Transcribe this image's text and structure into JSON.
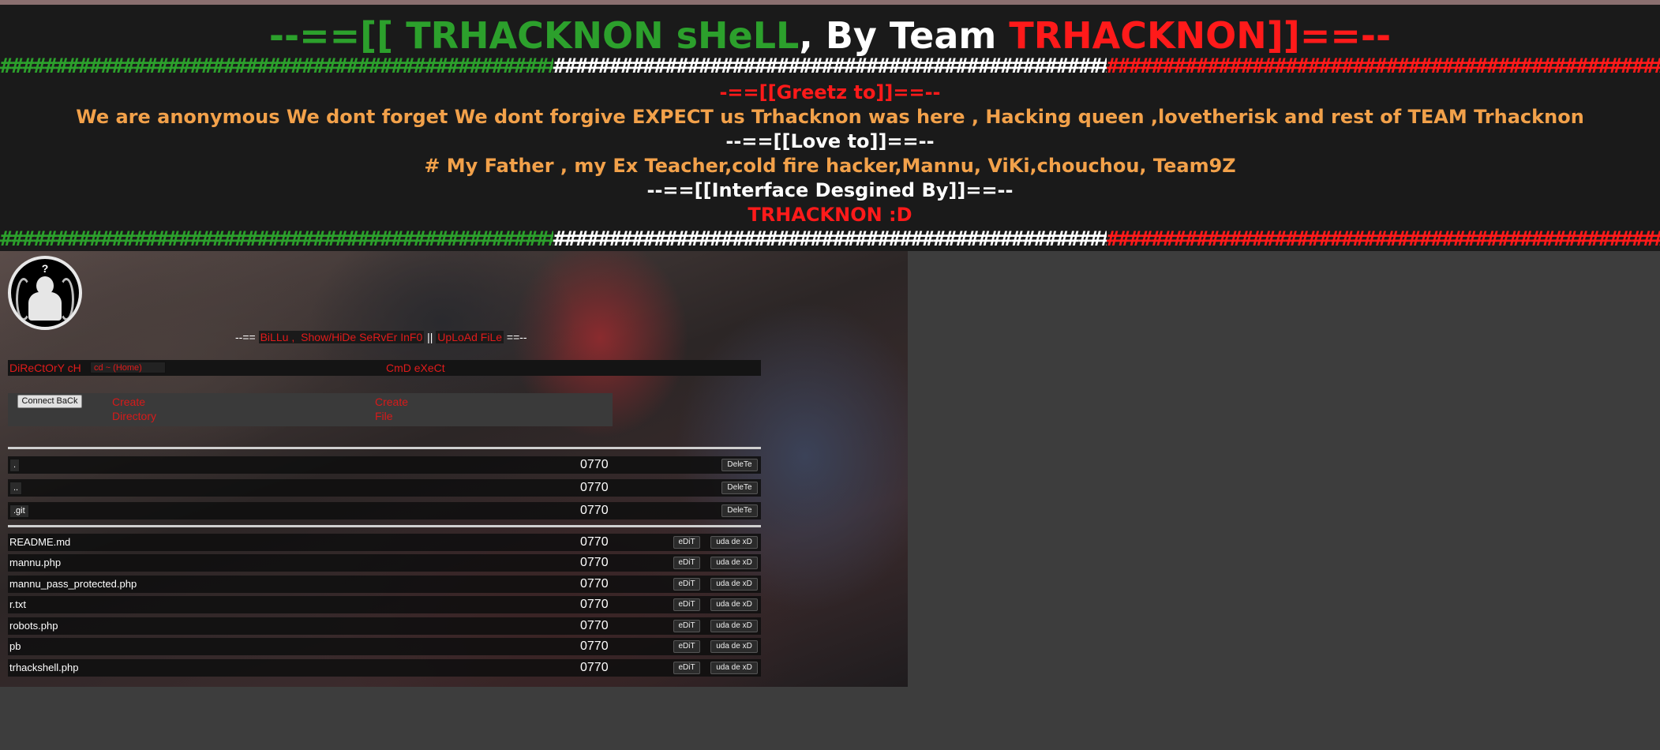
{
  "banner": {
    "title_part1": "--==[[ TRHACKNON sHeLL",
    "title_part2": ", By Team ",
    "title_part3": "TRHACKNON",
    "title_part4": "]]==--",
    "hash_text": "##########################################################################################",
    "greetz_heading": "-==[[Greetz to]]==--",
    "greetz_text": "We are anonymous We dont forget We dont forgive EXPECT us Trhacknon was here , Hacking queen ,lovetherisk and rest of TEAM Trhacknon",
    "love_heading": "--==[[Love to]]==--",
    "love_text": "# My Father , my Ex Teacher,cold fire hacker,Mannu, ViKi,chouchou, Team9Z",
    "interface_heading": "--==[[Interface Desgined By]]==--",
    "interface_text": "TRHACKNON :D",
    "colors": {
      "green": "#2ca02c",
      "white": "#ffffff",
      "red": "#ff1a1a",
      "orange": "#f2a14a",
      "background": "#1a1a1a"
    }
  },
  "shell": {
    "logo": {
      "icon": "anonymous-logo-icon",
      "mark": "?"
    },
    "links": {
      "prefix": "--==",
      "billu": "BiLLu",
      "sep1": ", ",
      "toggle_info": "Show/HiDe SeRvEr InF0",
      "sep2": " || ",
      "upload": "UpLoAd FiLe",
      "suffix": "==--"
    },
    "directory_label": "DiReCtOrY cH",
    "directory_value": "cd ~ (Home)",
    "cmd_label": "CmD eXeCt",
    "connect_back": "Connect BaCk",
    "create_dir": [
      "Create",
      "Directory"
    ],
    "create_file": [
      "Create",
      "File"
    ],
    "directories": [
      {
        "name": ".",
        "perm": "0770",
        "action": "DeleTe"
      },
      {
        "name": "..",
        "perm": "0770",
        "action": "DeleTe"
      },
      {
        "name": ".git",
        "perm": "0770",
        "action": "DeleTe"
      }
    ],
    "files": [
      {
        "name": "README.md",
        "perm": "0770",
        "edit": "eDiT",
        "delete": "uda de xD"
      },
      {
        "name": "mannu.php",
        "perm": "0770",
        "edit": "eDiT",
        "delete": "uda de xD"
      },
      {
        "name": "mannu_pass_protected.php",
        "perm": "0770",
        "edit": "eDiT",
        "delete": "uda de xD"
      },
      {
        "name": "r.txt",
        "perm": "0770",
        "edit": "eDiT",
        "delete": "uda de xD"
      },
      {
        "name": "robots.php",
        "perm": "0770",
        "edit": "eDiT",
        "delete": "uda de xD"
      },
      {
        "name": "pb",
        "perm": "0770",
        "edit": "eDiT",
        "delete": "uda de xD"
      },
      {
        "name": "trhackshell.php",
        "perm": "0770",
        "edit": "eDiT",
        "delete": "uda de xD"
      }
    ]
  }
}
